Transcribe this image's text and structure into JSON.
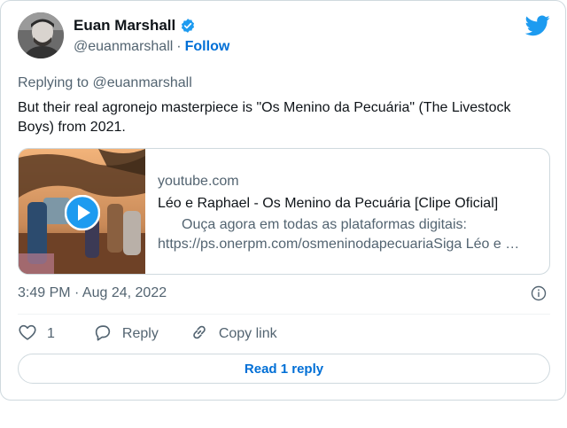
{
  "author": {
    "display_name": "Euan Marshall",
    "handle": "@euanmarshall",
    "separator": "·",
    "follow_label": "Follow",
    "verified_icon": "verified-badge-icon"
  },
  "brand": {
    "icon": "twitter-bird-icon",
    "color": "#1d9bf0"
  },
  "tweet": {
    "replying_to": "Replying to @euanmarshall",
    "text": "But their real agronejo masterpiece is \"Os Menino da Pecuária\" (The Livestock Boys) from 2021.",
    "timestamp": "3:49 PM · Aug 24, 2022"
  },
  "link_card": {
    "domain": "youtube.com",
    "title": "Léo e Raphael - Os Menino da Pecuária [Clipe Oficial]",
    "description_line1": "Ouça agora em todas as plataformas digitais:",
    "description_line2": "https://ps.onerpm.com/osmeninodapecuariaSiga Léo e …",
    "thumbnail_icon": "play-icon"
  },
  "actions": {
    "like_count": "1",
    "reply_label": "Reply",
    "copy_link_label": "Copy link"
  },
  "read_replies_label": "Read 1 reply",
  "colors": {
    "accent": "#1d9bf0",
    "link": "#006fd6",
    "secondary_text": "#536471",
    "border": "#cfd9de"
  }
}
